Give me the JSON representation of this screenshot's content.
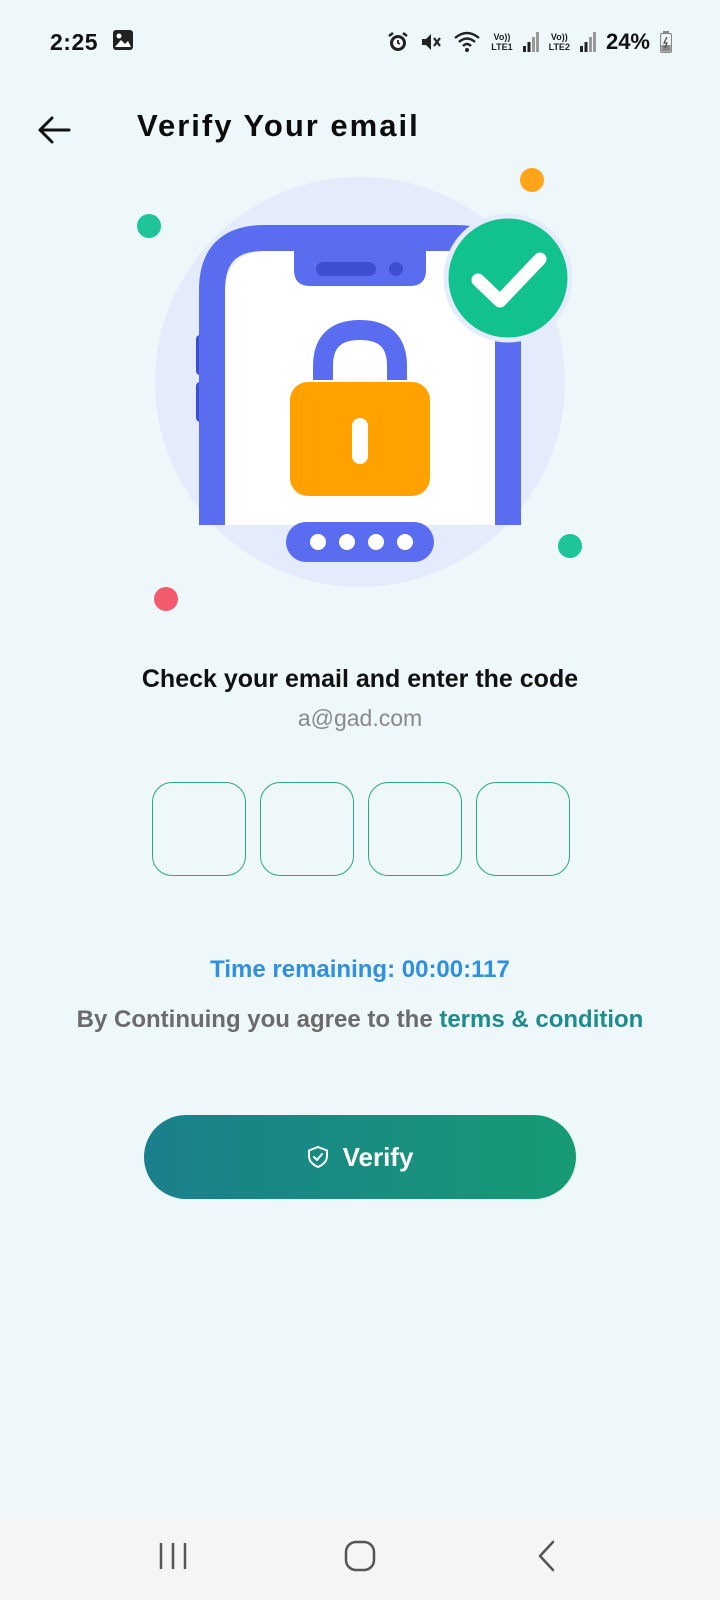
{
  "status_bar": {
    "time": "2:25",
    "sim1_label_top": "Vo))",
    "sim1_label_bottom": "LTE1",
    "sim2_label_top": "Vo))",
    "sim2_label_bottom": "LTE2",
    "battery": "24%",
    "icons": [
      "gallery-icon",
      "alarm-icon",
      "mute-icon",
      "wifi-icon",
      "signal-icon",
      "battery-icon"
    ]
  },
  "header": {
    "title": "Verify Your email",
    "back_icon": "arrow-left-icon"
  },
  "illustration": {
    "icons": [
      "phone-icon",
      "lock-icon",
      "check-badge-icon",
      "password-dots-icon"
    ],
    "colors": {
      "circle_bg": "#e4ecfb",
      "phone": "#5a6cf0",
      "lock": "#ffa200",
      "check": "#11c28e",
      "dot_orange": "#ffa41b",
      "dot_green": "#1ec49a",
      "dot_red": "#f45a6e"
    }
  },
  "prompt": {
    "text": "Check your email and enter the code",
    "email": "a@gad.com"
  },
  "otp": {
    "digits": [
      "",
      "",
      "",
      ""
    ]
  },
  "timer": {
    "text": "Time remaining: 00:00:117"
  },
  "terms": {
    "prefix": "By Continuing you agree to the ",
    "link": "terms & condition"
  },
  "verify_button": {
    "label": "Verify",
    "icon": "shield-check-icon"
  },
  "nav_bar": {
    "icons": [
      "recent-apps-icon",
      "home-icon",
      "back-icon"
    ]
  },
  "colors": {
    "background": "#eef7f9",
    "accent": "#1e8c8c",
    "timer": "#2f8fe0",
    "otp_border": "#2aa77f"
  }
}
